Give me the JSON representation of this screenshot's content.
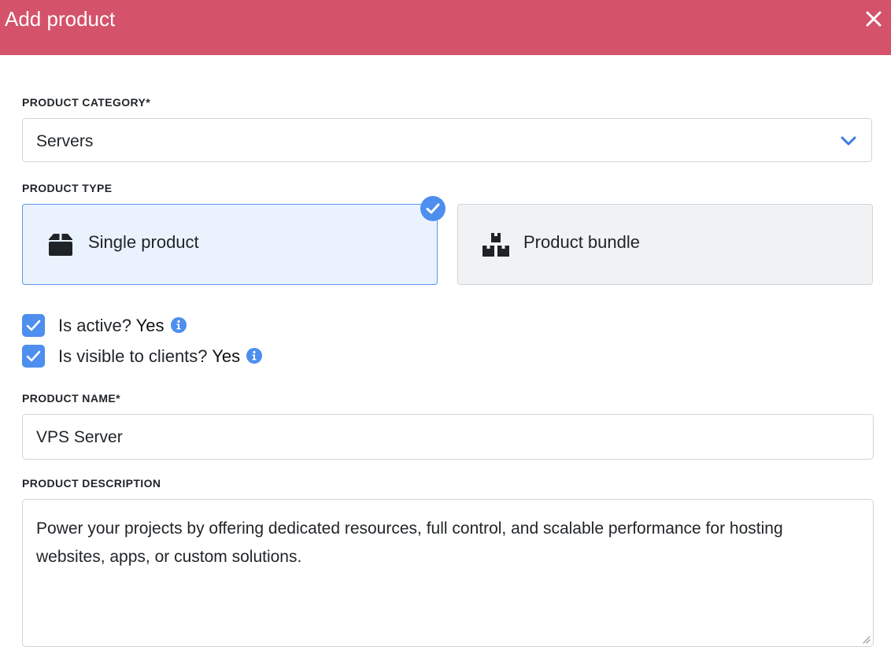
{
  "header": {
    "title": "Add product",
    "close_icon": "close-icon"
  },
  "category": {
    "label": "PRODUCT CATEGORY*",
    "value": "Servers",
    "icon": "chevron-down-icon"
  },
  "product_type": {
    "label": "PRODUCT TYPE",
    "options": [
      {
        "label": "Single product",
        "icon": "box-icon",
        "selected": true
      },
      {
        "label": "Product bundle",
        "icon": "boxes-icon",
        "selected": false
      }
    ]
  },
  "flags": {
    "active": {
      "label": "Is active?",
      "value": "Yes",
      "checked": true
    },
    "visible": {
      "label": "Is visible to clients?",
      "value": "Yes",
      "checked": true
    }
  },
  "name": {
    "label": "PRODUCT NAME*",
    "value": "VPS Server"
  },
  "description": {
    "label": "PRODUCT DESCRIPTION",
    "value": "Power your projects by offering dedicated resources, full control, and scalable performance for hosting websites, apps, or custom solutions."
  },
  "colors": {
    "header": "#d4526a",
    "accent": "#4d8eee",
    "selected_bg": "#eaf2fe"
  }
}
